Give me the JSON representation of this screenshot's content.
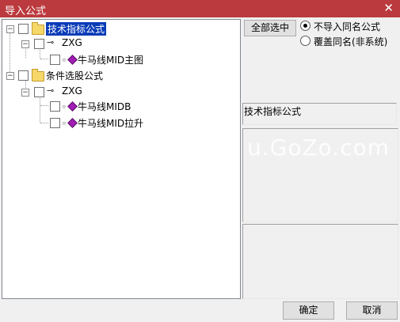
{
  "window": {
    "title": "导入公式",
    "close_glyph": "✕"
  },
  "tree": {
    "root1": {
      "label": "技术指标公式",
      "group": {
        "label": "ZXG",
        "items": [
          "牛马线MID主图"
        ]
      }
    },
    "root2": {
      "label": "条件选股公式",
      "group": {
        "label": "ZXG",
        "items": [
          "牛马线MIDB",
          "牛马线MID拉升"
        ]
      }
    }
  },
  "options": {
    "select_all": "全部选中",
    "skip_same_name": "不导入同名公式",
    "overwrite_same_name": "覆盖同名(非系统)",
    "selected": "skip_same_name"
  },
  "right_panel": {
    "formula_type": "技术指标公式"
  },
  "buttons": {
    "ok": "确定",
    "cancel": "取消"
  },
  "watermark": "u.GoZo.com"
}
